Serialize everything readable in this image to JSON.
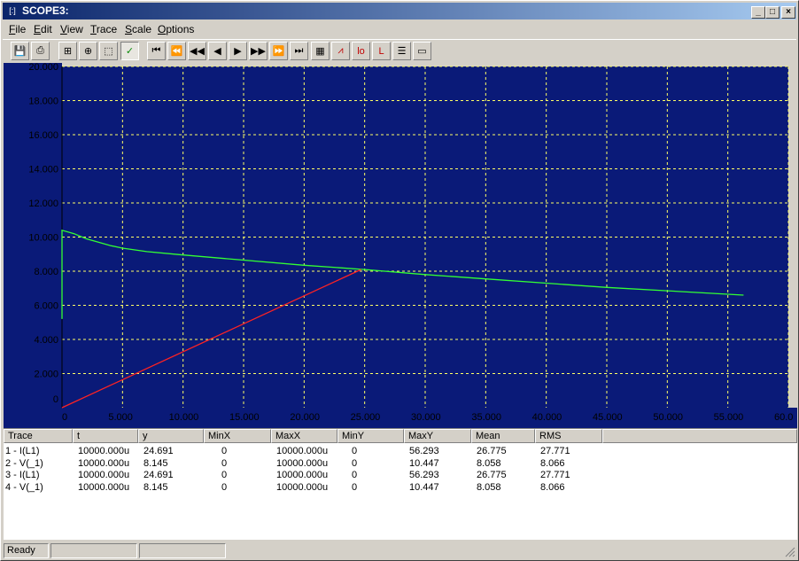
{
  "window": {
    "title": "SCOPE3:",
    "app_icon_label": "[:]"
  },
  "menu": [
    "File",
    "Edit",
    "View",
    "Trace",
    "Scale",
    "Options"
  ],
  "toolbar": [
    {
      "name": "save-icon",
      "glyph": "💾"
    },
    {
      "name": "print-icon",
      "glyph": "⎙"
    },
    {
      "name": "cursor-mode-icon",
      "glyph": "⊞"
    },
    {
      "name": "target-icon",
      "glyph": "⊕"
    },
    {
      "name": "zoom-box-icon",
      "glyph": "⬚"
    },
    {
      "name": "check-icon",
      "glyph": "✓"
    },
    {
      "name": "first-icon",
      "glyph": "⏮"
    },
    {
      "name": "fast-rewind-icon",
      "glyph": "⏪"
    },
    {
      "name": "rewind-icon",
      "glyph": "◀◀"
    },
    {
      "name": "step-back-icon",
      "glyph": "◀"
    },
    {
      "name": "step-forward-icon",
      "glyph": "▶"
    },
    {
      "name": "forward-icon",
      "glyph": "▶▶"
    },
    {
      "name": "fast-forward-icon",
      "glyph": "⏩"
    },
    {
      "name": "last-icon",
      "glyph": "⏭"
    },
    {
      "name": "table-icon",
      "glyph": "▦"
    },
    {
      "name": "plot-a-icon",
      "glyph": "⩘"
    },
    {
      "name": "plot-b-icon",
      "glyph": "lo"
    },
    {
      "name": "plot-c-icon",
      "glyph": "L"
    },
    {
      "name": "list-icon",
      "glyph": "☰"
    },
    {
      "name": "window-icon",
      "glyph": "▭"
    }
  ],
  "colors": {
    "plot_bg": "#0a1a78",
    "grid": "#ffff66",
    "trace_green": "#33ff33",
    "trace_red": "#ff2222",
    "axis_text": "#000000"
  },
  "chart_data": {
    "type": "line",
    "title": "",
    "xlabel": "",
    "ylabel": "",
    "xlim": [
      0,
      60
    ],
    "ylim": [
      0,
      20
    ],
    "x_ticks": [
      "0",
      "5.000",
      "10.000",
      "15.000",
      "20.000",
      "25.000",
      "30.000",
      "35.000",
      "40.000",
      "45.000",
      "50.000",
      "55.000",
      "60.0"
    ],
    "y_ticks": [
      "0",
      "2.000",
      "4.000",
      "6.000",
      "8.000",
      "10.000",
      "12.000",
      "14.000",
      "16.000",
      "18.000",
      "20.000"
    ],
    "grid": true,
    "series": [
      {
        "color": "#33ff33",
        "points": [
          [
            0,
            5.2
          ],
          [
            0,
            10.4
          ],
          [
            1,
            10.2
          ],
          [
            2,
            9.9
          ],
          [
            3,
            9.7
          ],
          [
            4,
            9.5
          ],
          [
            5,
            9.35
          ],
          [
            7,
            9.15
          ],
          [
            10,
            8.95
          ],
          [
            15,
            8.65
          ],
          [
            20,
            8.35
          ],
          [
            25,
            8.1
          ],
          [
            30,
            7.8
          ],
          [
            35,
            7.55
          ],
          [
            40,
            7.3
          ],
          [
            45,
            7.05
          ],
          [
            50,
            6.85
          ],
          [
            56.3,
            6.6
          ]
        ]
      },
      {
        "color": "#ff2222",
        "points": [
          [
            0,
            0
          ],
          [
            24.7,
            8.1
          ]
        ]
      }
    ]
  },
  "table": {
    "headers": [
      "Trace",
      "t",
      "y",
      "MinX",
      "MaxX",
      "MinY",
      "MaxY",
      "Mean",
      "RMS"
    ],
    "rows": [
      [
        "1 - I(L1)",
        "10000.000u",
        "24.691",
        "0",
        "10000.000u",
        "0",
        "56.293",
        "26.775",
        "27.771"
      ],
      [
        "2 - V(_1)",
        "10000.000u",
        "8.145",
        "0",
        "10000.000u",
        "0",
        "10.447",
        "8.058",
        "8.066"
      ],
      [
        "3 - I(L1)",
        "10000.000u",
        "24.691",
        "0",
        "10000.000u",
        "0",
        "56.293",
        "26.775",
        "27.771"
      ],
      [
        "4 - V(_1)",
        "10000.000u",
        "8.145",
        "0",
        "10000.000u",
        "0",
        "10.447",
        "8.058",
        "8.066"
      ]
    ]
  },
  "status": {
    "text": "Ready",
    "pane2": "",
    "pane3": ""
  }
}
